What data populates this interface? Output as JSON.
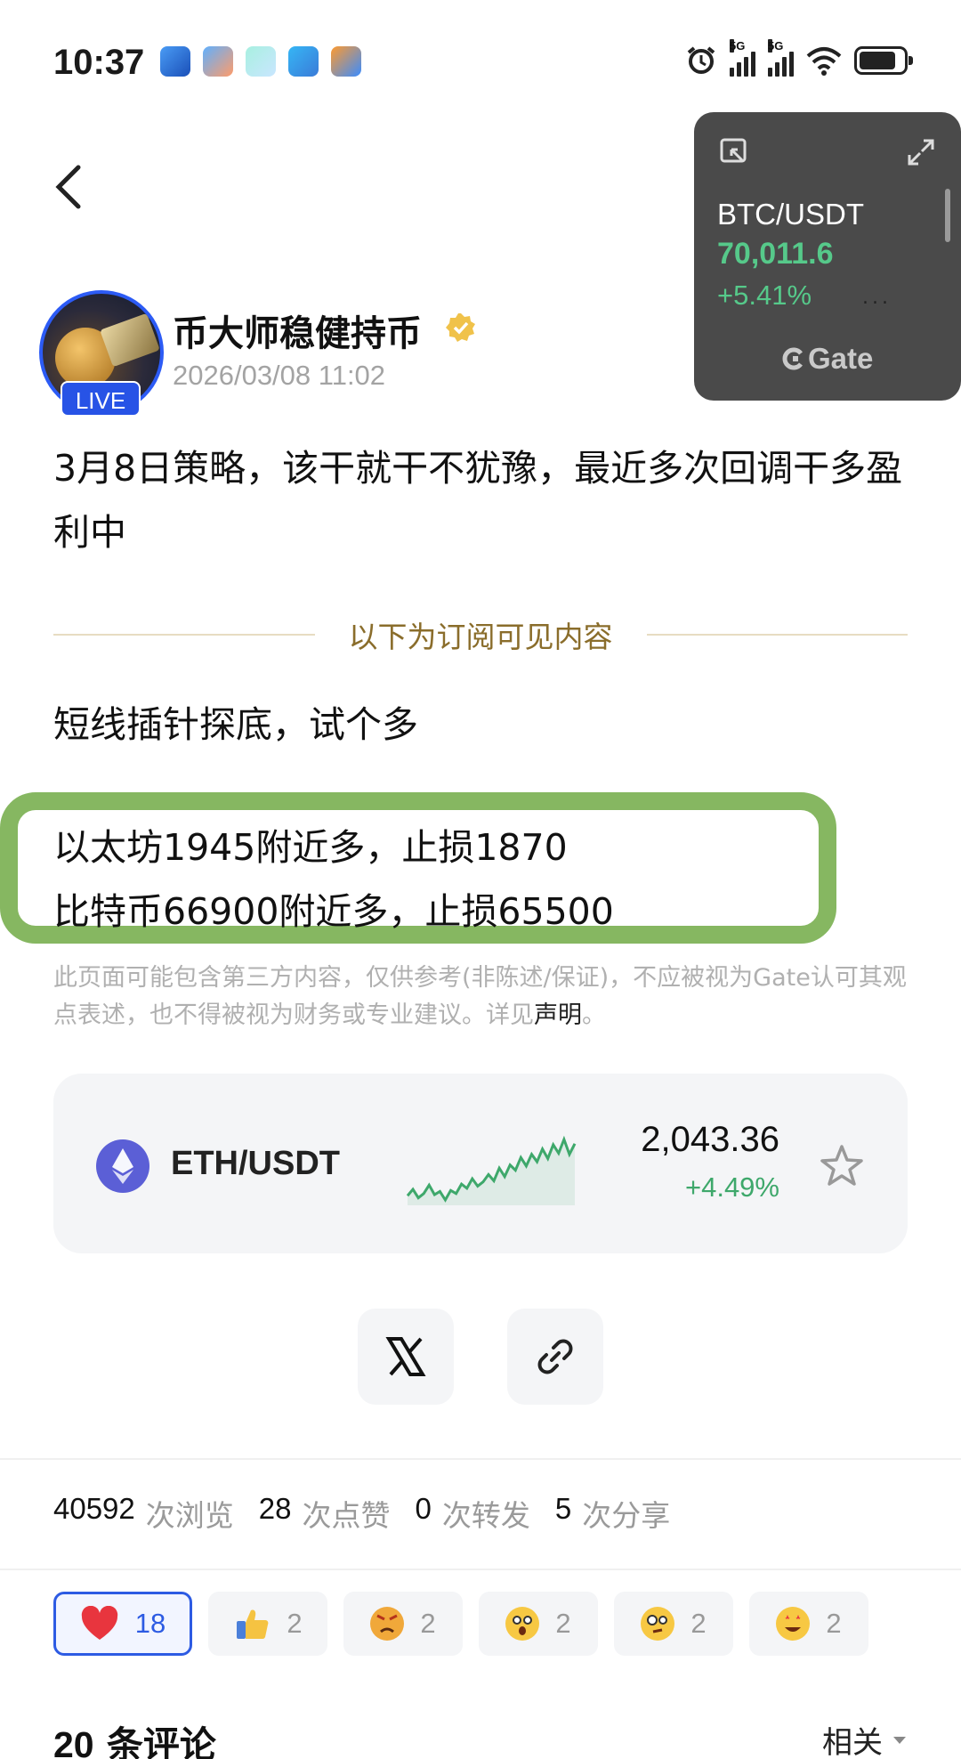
{
  "status_bar": {
    "time": "10:37",
    "net1": "5G",
    "net2": "5G"
  },
  "float_ticker": {
    "pair": "BTC/USDT",
    "price": "70,011.6",
    "change": "+5.41%",
    "brand": "Gate",
    "dots": "..."
  },
  "author": {
    "name": "币大师稳健持币",
    "time": "2026/03/08 11:02",
    "live": "LIVE"
  },
  "post": {
    "body": "3月8日策略，该干就干不犹豫，最近多次回调干多盈利中",
    "divider_label": "以下为订阅可见内容",
    "short_line": "短线插针探底，试个多",
    "highlight_line1": "以太坊1945附近多，止损1870",
    "highlight_line2": "比特币66900附近多，止损65500",
    "disclaimer": "此页面可能包含第三方内容，仅供参考(非陈述/保证)，不应被视为Gate认可其观点表述，也不得被视为财务或专业建议。详见",
    "disclaimer_link": "声明",
    "disclaimer_end": "。"
  },
  "ticker": {
    "pair": "ETH/USDT",
    "price": "2,043.36",
    "change": "+4.49%",
    "sparkline": [
      2.0,
      2.6,
      1.8,
      2.2,
      3.0,
      2.1,
      2.4,
      1.6,
      2.5,
      2.2,
      3.1,
      2.7,
      3.6,
      2.9,
      3.3,
      4.0,
      3.4,
      4.6,
      3.8,
      4.9,
      4.4,
      5.6,
      4.8,
      5.9,
      5.2,
      6.4,
      5.5,
      6.8,
      6.0,
      7.3,
      5.9,
      6.9
    ]
  },
  "stats": [
    {
      "num": "40592",
      "label": "次浏览"
    },
    {
      "num": "28",
      "label": "次点赞"
    },
    {
      "num": "0",
      "label": "次转发"
    },
    {
      "num": "5",
      "label": "次分享"
    }
  ],
  "reactions": [
    {
      "icon": "heart-icon",
      "count": "18"
    },
    {
      "icon": "thumbs-up-icon",
      "count": "2"
    },
    {
      "icon": "angry-face-icon",
      "count": "2"
    },
    {
      "icon": "shocked-face-icon",
      "count": "2"
    },
    {
      "icon": "thinking-face-icon",
      "count": "2"
    },
    {
      "icon": "star-eyes-face-icon",
      "count": "2"
    }
  ],
  "comments": {
    "count": "20",
    "label": "条评论",
    "sort": "相关"
  },
  "colors": {
    "accent": "#2d5be3",
    "up": "#3ea86b",
    "highlight_border": "#86b761",
    "gold": "#8a6d2b"
  }
}
